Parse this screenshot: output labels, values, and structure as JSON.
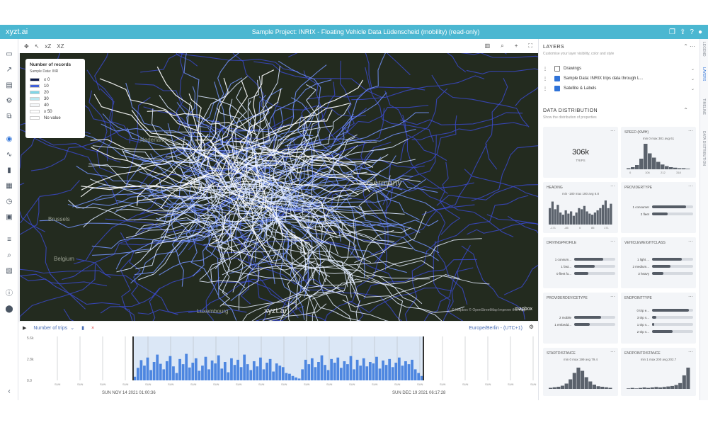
{
  "app": {
    "brand": "xyzt.ai",
    "title": "Sample Project: INRIX - Floating Vehicle Data Lüdenscheid (mobility) (read-only)",
    "top_icons": [
      "bookmark-icon",
      "share-icon",
      "help-icon",
      "account-icon"
    ]
  },
  "left_toolbar": {
    "icons": [
      "folder-icon",
      "trend-icon",
      "folder-open-icon",
      "settings-icon",
      "copy-icon",
      "globe-icon",
      "line-chart-icon",
      "bar-chart-icon",
      "grid-icon",
      "clock-icon",
      "dashboard-icon",
      "list-icon",
      "zoom-icon",
      "map-icon",
      "info-icon",
      "location-icon",
      "collapse-icon"
    ],
    "active_index": 5
  },
  "map_toolbar": {
    "left_icons": [
      "move-icon",
      "pointer-icon"
    ],
    "left_labels": [
      "xZ",
      "XZ"
    ],
    "right_icons": [
      "layers-icon",
      "search-icon",
      "plus-icon",
      "fullscreen-icon"
    ]
  },
  "legend": {
    "title": "Number of records",
    "subtitle": "Sample Data: INR",
    "items": [
      {
        "label": "≤ 0",
        "color": "#0d1a4a"
      },
      {
        "label": "10",
        "color": "#4060d8"
      },
      {
        "label": "20",
        "color": "#7fd7e8"
      },
      {
        "label": "30",
        "color": "#b9e7f0"
      },
      {
        "label": "40",
        "color": "#f3f6f8"
      },
      {
        "label": "≥ 50",
        "color": "#ffffff"
      },
      {
        "label": "No value",
        "color": "#ffffff"
      }
    ]
  },
  "map": {
    "country_label": "Germany",
    "city_labels": [
      "Brussels",
      "Belgium",
      "Luxembourg",
      "Nederland"
    ],
    "watermark": "xyzt.ai",
    "mapbox_label": "mapbox",
    "attribution": "© Mapbox © OpenStreetMap Improve this map"
  },
  "timeline": {
    "metric": "Number of trips",
    "timezone": "Europe/Berlin - (UTC+1)",
    "y_ticks": [
      "5.6k",
      "2.8k",
      "0.0"
    ],
    "start_label": "SUN NOV 14 2021 01:00:36",
    "end_label": "SUN DEC 19 2021 06:17:28",
    "day_label": "SUN",
    "bars": [
      10,
      34,
      55,
      40,
      62,
      28,
      50,
      70,
      45,
      30,
      52,
      66,
      38,
      20,
      58,
      44,
      72,
      35,
      48,
      60,
      26,
      40,
      64,
      30,
      54,
      46,
      68,
      32,
      50,
      22,
      60,
      42,
      56,
      36,
      70,
      44,
      28,
      52,
      38,
      62,
      30,
      48,
      58,
      24,
      46,
      40,
      36,
      20,
      18,
      12,
      8,
      5,
      30,
      56,
      44,
      60,
      36,
      50,
      68,
      42,
      28,
      58,
      48,
      62,
      34,
      52,
      44,
      66,
      30,
      56,
      40,
      60,
      38,
      50,
      46,
      64,
      32,
      54,
      42,
      58,
      36,
      48,
      62,
      40,
      52,
      44,
      56,
      30,
      20,
      12
    ]
  },
  "right_panel": {
    "layers_title": "LAYERS",
    "layers_subtitle": "Customise your layer visibility, color and style",
    "layers": [
      {
        "name": "Drawings",
        "checked": false
      },
      {
        "name": "Sample Data: INRIX trips data through L...",
        "checked": true
      },
      {
        "name": "Satellite & Labels",
        "checked": true
      }
    ],
    "dist_title": "DATA DISTRIBUTION",
    "dist_subtitle": "Show the distribution of properties",
    "trips_card": {
      "value": "306k",
      "unit": "TRIPS"
    },
    "speed_card": {
      "title": "SPEED (KM/H)",
      "stats": "min 0 max 381 avg 61",
      "ticks": [
        "0",
        "106",
        "212",
        "318"
      ],
      "bars": [
        2,
        4,
        8,
        20,
        48,
        30,
        22,
        14,
        9,
        6,
        4,
        3,
        2,
        2,
        1
      ]
    },
    "heading_card": {
      "title": "HEADING",
      "stats": "min -180 max 180 avg 6.8",
      "ticks": [
        "-171",
        "-85",
        "0",
        "85",
        "171"
      ],
      "bars": [
        30,
        42,
        28,
        36,
        22,
        18,
        26,
        20,
        24,
        16,
        22,
        30,
        28,
        34,
        24,
        20,
        18,
        22,
        26,
        30,
        36,
        44,
        30,
        38
      ]
    },
    "providertype_card": {
      "title": "PROVIDERTYPE",
      "rows": [
        {
          "label": "1 consumer",
          "value": 0.82
        },
        {
          "label": "2 fleet",
          "value": 0.38
        }
      ]
    },
    "drivingprofile_card": {
      "title": "DRIVINGPROFILE",
      "rows": [
        {
          "label": "1 consum...",
          "value": 0.7
        },
        {
          "label": "1 fast...",
          "value": 0.5
        },
        {
          "label": "0 fleet fo...",
          "value": 0.35
        }
      ]
    },
    "vehicleweight_card": {
      "title": "VEHICLEWEIGHTCLASS",
      "rows": [
        {
          "label": "1 light ...",
          "value": 0.72
        },
        {
          "label": "2 medium...",
          "value": 0.45
        },
        {
          "label": "3 heavy",
          "value": 0.28
        }
      ]
    },
    "provider_card": {
      "title": "PROVIDERDEVICETYPE",
      "rows": [
        {
          "label": "2 mobile",
          "value": 0.65
        },
        {
          "label": "1 embedd...",
          "value": 0.38
        }
      ]
    },
    "endpoint_card": {
      "title": "ENDPOINTTYPE",
      "rows": [
        {
          "label": "0 trip e...",
          "value": 0.9
        },
        {
          "label": "3 trip s...",
          "value": 0.1
        },
        {
          "label": "1 trip s...",
          "value": 0.06
        },
        {
          "label": "2 trip s...",
          "value": 0.5
        }
      ]
    },
    "startdist_card": {
      "title": "STARTDISTANCE",
      "stats": "min 0 max 199 avg 79.4",
      "bars": [
        2,
        3,
        4,
        6,
        10,
        18,
        30,
        40,
        34,
        22,
        14,
        8,
        5,
        4,
        3,
        2
      ]
    },
    "endpointdist_card": {
      "title": "ENDPOINTDISTANCE",
      "stats": "min 1 max 200 avg 202.7",
      "bars": [
        1,
        2,
        1,
        2,
        3,
        2,
        3,
        4,
        3,
        4,
        5,
        6,
        8,
        12,
        28,
        44
      ]
    }
  },
  "right_side_tabs": [
    "LEGEND",
    "LAYERS",
    "TIMELINE",
    "DATA DISTRIBUTION"
  ]
}
